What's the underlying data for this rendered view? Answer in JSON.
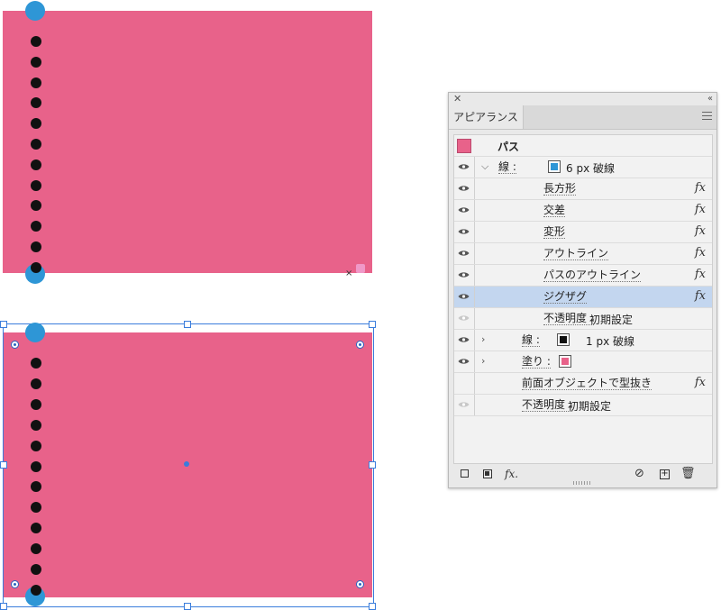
{
  "panel": {
    "title": "アピアランス",
    "close_icon": "close-icon",
    "collapse_icon": "double-chevron-left-icon",
    "menu_icon": "hamburger-menu-icon",
    "colors": {
      "fill": "#e8628a",
      "stroke_blue": "#2e96d6",
      "stroke_black": "#111111",
      "selected_row": "#c3d6ef"
    },
    "header_label": "パス",
    "rows": [
      {
        "label": "線 :",
        "value": "6 px 破線",
        "swatch_color": "#2e96d6",
        "expanded": true
      },
      {
        "label": "長方形",
        "fx": "fx"
      },
      {
        "label": "交差",
        "fx": "fx"
      },
      {
        "label": "変形",
        "fx": "fx"
      },
      {
        "label": "アウトライン",
        "fx": "fx"
      },
      {
        "label": "パスのアウトライン",
        "fx": "fx"
      },
      {
        "label": "ジグザグ",
        "fx": "fx",
        "selected": true
      },
      {
        "label": "不透明度 :",
        "value": "初期設定"
      },
      {
        "label": "線 :",
        "value": "1 px 破線",
        "swatch_color": "#111111",
        "expanded": false
      },
      {
        "label": "塗り :",
        "swatch_color": "#e8628a",
        "expanded": false
      },
      {
        "label": "前面オブジェクトで型抜き",
        "fx": "fx"
      },
      {
        "label": "不透明度 :",
        "value": "初期設定"
      }
    ],
    "footer": {
      "add_stroke_icon": "add-stroke-icon",
      "add_fill_icon": "add-fill-icon",
      "fx_label": "fx.",
      "clear_icon": "clear-appearance-icon",
      "duplicate_icon": "duplicate-item-icon",
      "delete_icon": "trash-icon"
    }
  },
  "artboard": {
    "marks": {
      "small_x": "×"
    }
  }
}
